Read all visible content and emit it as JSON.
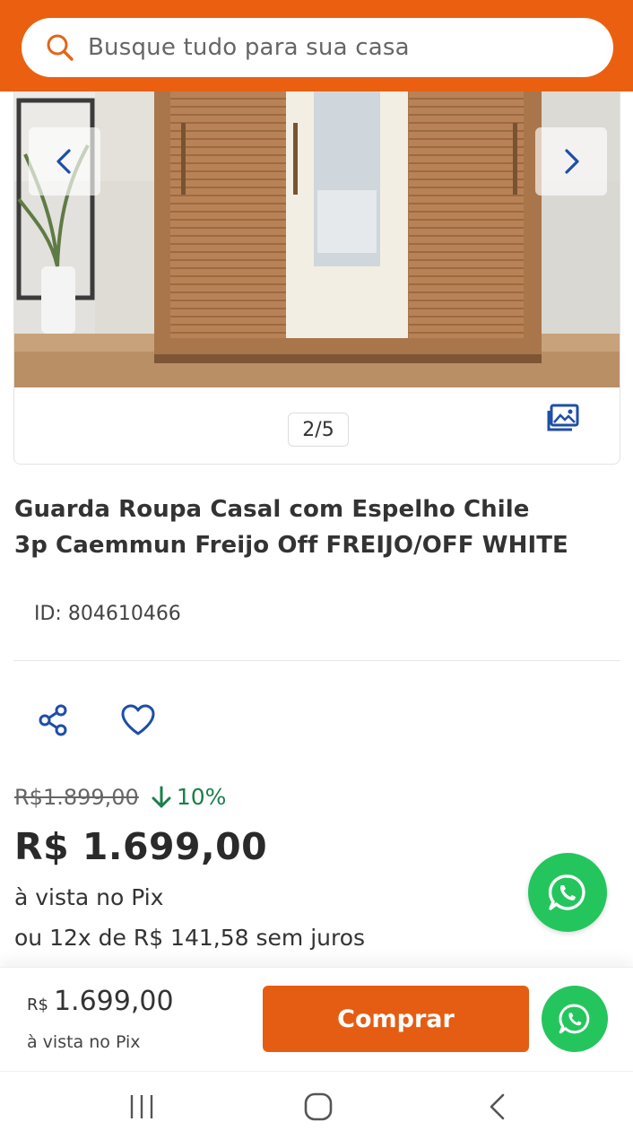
{
  "header": {
    "search_placeholder": "Busque tudo para sua casa",
    "accent": "#ea6010"
  },
  "gallery": {
    "counter": "2/5",
    "prev_icon": "chevron-left-icon",
    "next_icon": "chevron-right-icon",
    "gallery_icon": "image-gallery-icon"
  },
  "product": {
    "title_line1": "Guarda Roupa Casal com Espelho Chile",
    "title_line2": "3p Caemmun Freijo Off FREIJO/OFF WHITE",
    "id_text": "ID: 804610466"
  },
  "actions": {
    "share_icon": "share-icon",
    "favorite_icon": "heart-icon"
  },
  "pricing": {
    "old_price": "R$1.899,00",
    "discount": "10%",
    "price": "R$ 1.699,00",
    "pix_note": "à vista no Pix",
    "installments": "ou 12x de R$ 141,58 sem juros",
    "discount_color": "#1a7f4a"
  },
  "buybar": {
    "currency": "R$",
    "value": "1.699,00",
    "pix_note": "à vista no Pix",
    "buy_label": "Comprar",
    "buy_color": "#e55d12",
    "whatsapp_color": "#25c55e"
  },
  "system_nav": {
    "recents_icon": "recents-icon",
    "home_icon": "home-icon",
    "back_icon": "back-icon"
  }
}
